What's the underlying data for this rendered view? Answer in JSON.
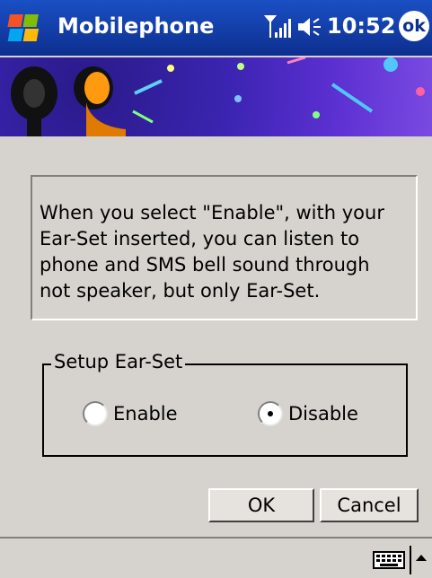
{
  "titlebar": {
    "app_title": "Mobilephone",
    "time": "10:52",
    "ok_label": "ok",
    "icons": [
      "windows-flag-icon",
      "signal-strength-icon",
      "volume-icon"
    ]
  },
  "banner": {
    "image": "ear-set headphones illustration"
  },
  "message": {
    "line1": "When you select \"Enable\", with your",
    "line2": "Ear-Set inserted, you can listen to",
    "line3": "phone and SMS bell sound through",
    "line4": "not speaker, but only Ear-Set."
  },
  "setup": {
    "group_label": "Setup Ear-Set",
    "options": [
      {
        "label": "Enable",
        "selected": false
      },
      {
        "label": "Disable",
        "selected": true
      }
    ]
  },
  "buttons": {
    "ok": "OK",
    "cancel": "Cancel"
  },
  "taskbar": {
    "icons": [
      "keyboard-icon",
      "sip-arrow-icon"
    ]
  }
}
